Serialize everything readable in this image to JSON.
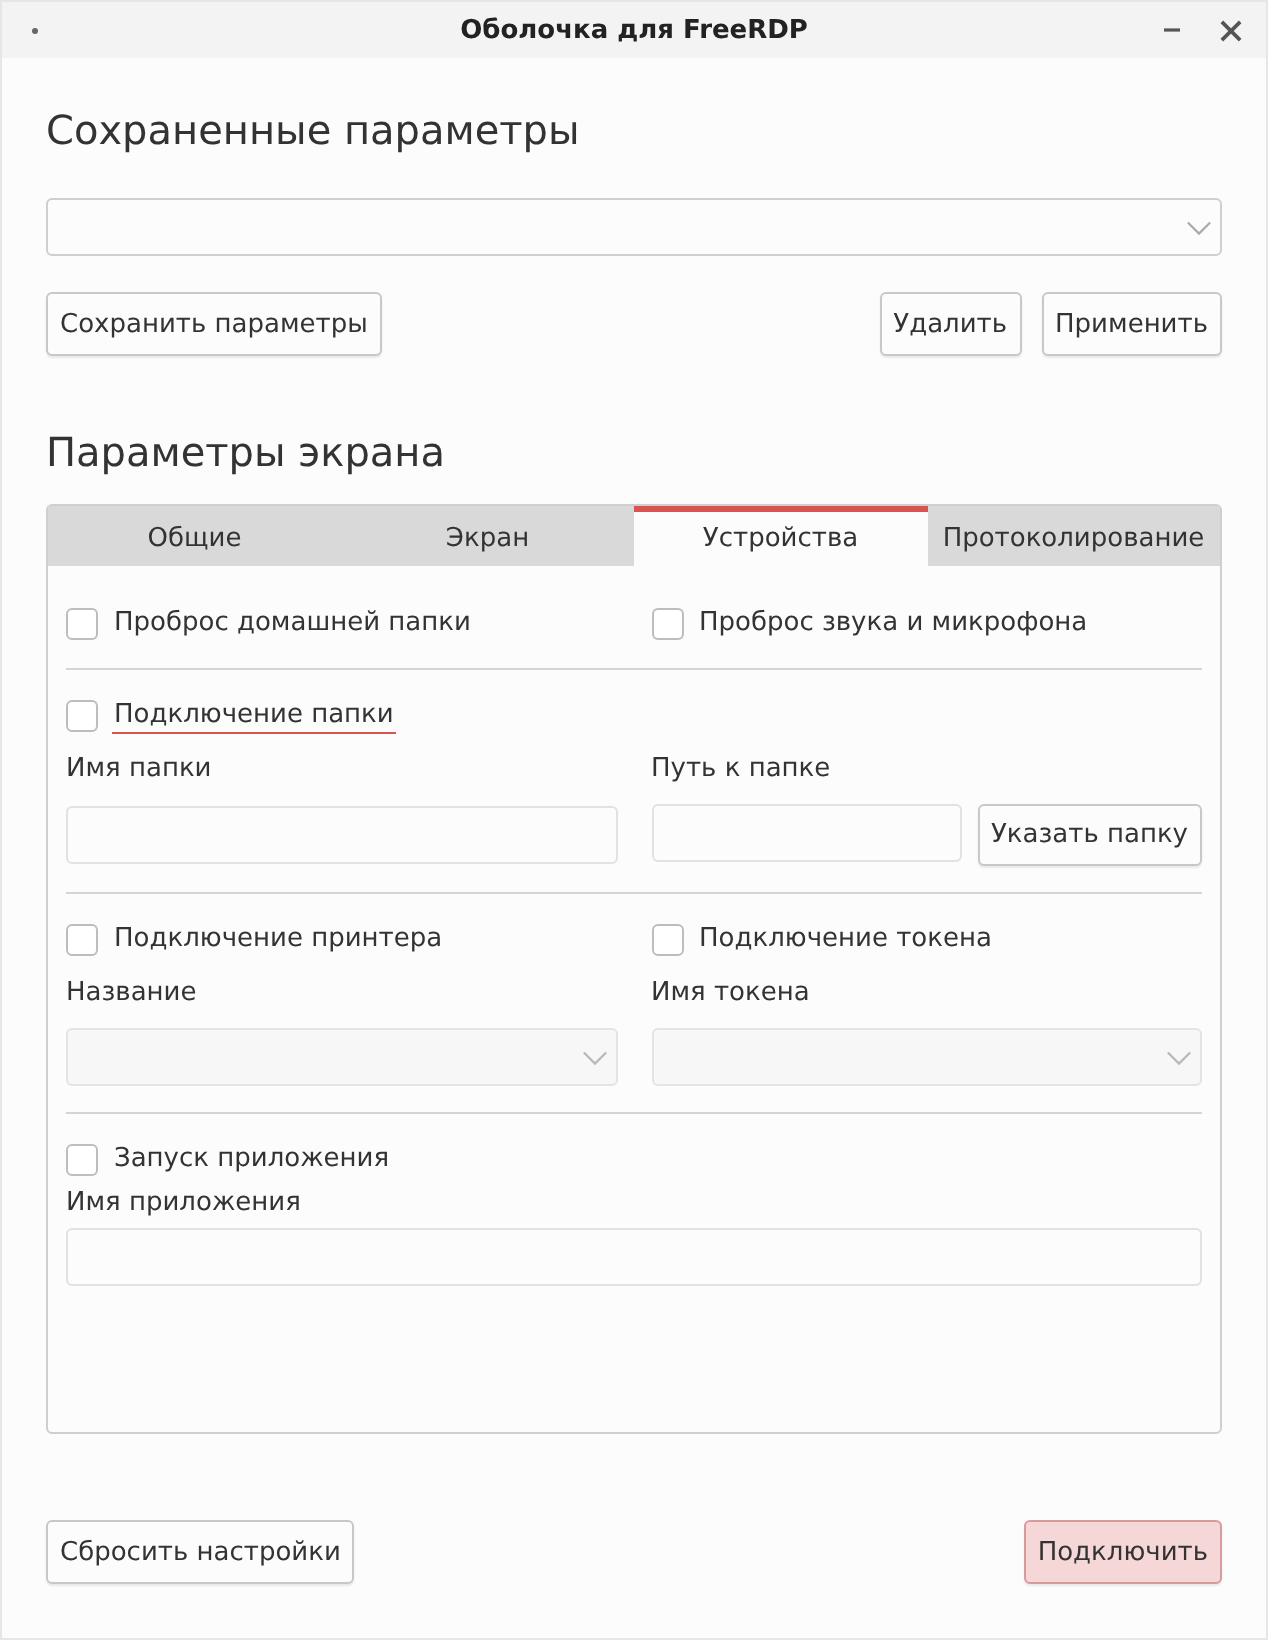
{
  "window": {
    "title": "Оболочка для FreeRDP"
  },
  "saved_params": {
    "heading": "Сохраненные параметры",
    "buttons": [
      {
        "label": "Сохранить параметры"
      },
      {
        "label": "Удалить"
      },
      {
        "label": "Применить"
      }
    ]
  },
  "screen_params": {
    "heading": "Параметры экрана",
    "tabs": [
      {
        "label": "Общие",
        "selected": false
      },
      {
        "label": "Экран",
        "selected": false
      },
      {
        "label": "Устройства",
        "selected": true
      },
      {
        "label": "Протоколирование",
        "selected": false
      }
    ],
    "sections": [
      {
        "kind": "checks",
        "checkboxes": [
          {
            "label": "Проброс домашней папки",
            "checked": false,
            "focused": false
          },
          {
            "label": "Проброс звука и микрофона",
            "checked": false,
            "focused": false
          }
        ]
      },
      {
        "kind": "folder",
        "checkbox": {
          "label": "Подключение папки",
          "checked": false,
          "focused": true
        },
        "fields": [
          {
            "label": "Имя папки"
          },
          {
            "label": "Путь к папке"
          }
        ],
        "button": "Указать папку"
      },
      {
        "kind": "selects",
        "columns": [
          {
            "checkbox": {
              "label": "Подключение принтера",
              "checked": false,
              "focused": false
            },
            "label": "Название",
            "disabled": true
          },
          {
            "checkbox": {
              "label": "Подключение токена",
              "checked": false,
              "focused": false
            },
            "label": "Имя токена",
            "disabled": true
          }
        ]
      },
      {
        "kind": "app",
        "checkbox": {
          "label": "Запуск приложения",
          "checked": false,
          "focused": false
        },
        "field_label": "Имя приложения"
      }
    ]
  },
  "footer": {
    "buttons": [
      {
        "label": "Сбросить настройки",
        "primary": false
      },
      {
        "label": "Подключить",
        "primary": true
      }
    ]
  }
}
